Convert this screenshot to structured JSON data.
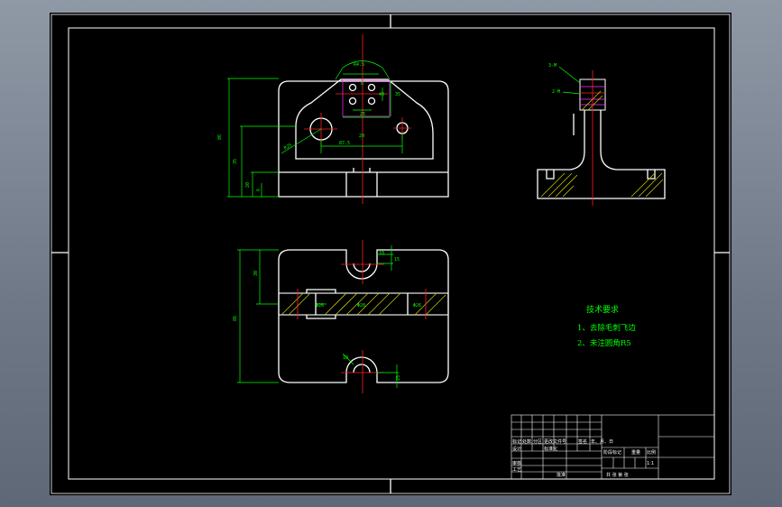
{
  "colors": {
    "background": "#000000",
    "outline": "#ffffff",
    "dimension": "#00ff00",
    "centerline": "#ff2020",
    "hatch": "#c8c800"
  },
  "dimensions": {
    "top_arc": "R4.5",
    "overall_height": "86",
    "height_2": "35",
    "height_3": "20",
    "height_4": "6",
    "small_1": "8",
    "small_2": "25",
    "small_3": "35",
    "small_4": "40",
    "r_left": "R25",
    "bore_span": "87.5",
    "bore_small": "20",
    "plan_height": "86",
    "plan_inner": "30",
    "plan_small": "15",
    "plan_slot": "10",
    "plan_d1": "Φ26",
    "plan_d2": "Φ20",
    "plan_d3": "Φ26",
    "plan_bottom": "10",
    "plan_bottom_2": "25",
    "side_label_1": "3-M",
    "side_label_2": "2-M"
  },
  "requirements": {
    "title": "技术要求",
    "items": [
      "1、去除毛刺飞边",
      "2、未注圆角R5"
    ]
  },
  "title_block": {
    "row_labels": [
      "标记",
      "处数",
      "分区",
      "更改文件号",
      "签名",
      "年、月、日"
    ],
    "designer": "设计",
    "standardization": "标准化",
    "reviewer": "审核",
    "process": "工艺",
    "approval": "批准",
    "stage_marker": "阶段标记",
    "weight": "重量",
    "scale": "比例",
    "scale_value": "1:1",
    "sheets": "共  张  第  张"
  }
}
